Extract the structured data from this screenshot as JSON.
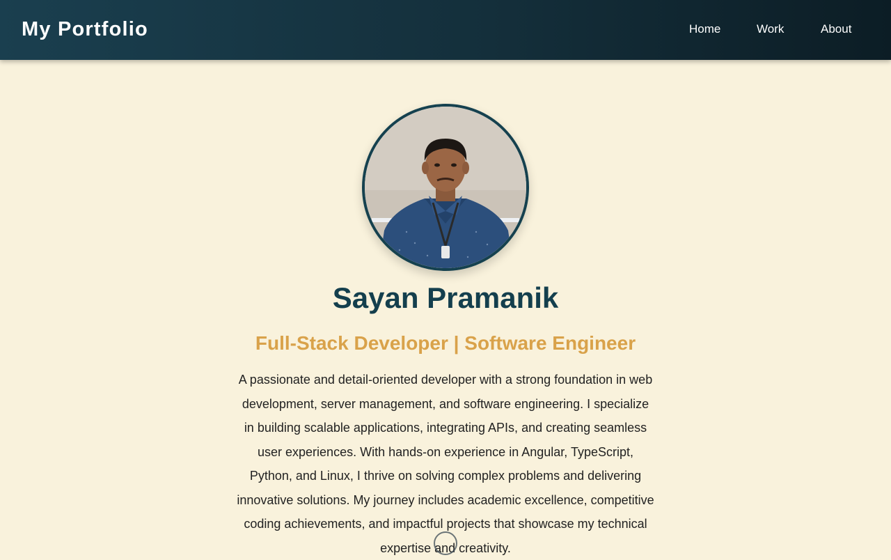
{
  "header": {
    "brand": "My Portfolio",
    "nav": [
      {
        "label": "Home"
      },
      {
        "label": "Work"
      },
      {
        "label": "About"
      }
    ]
  },
  "profile": {
    "photo_icon": "profile-photo",
    "name": "Sayan Pramanik",
    "title": "Full-Stack Developer | Software Engineer",
    "bio": "A passionate and detail-oriented developer with a strong foundation in web development, server management, and software engineering. I specialize in building scalable applications, integrating APIs, and creating seamless user experiences. With hands-on experience in Angular, TypeScript, Python, and Linux, I thrive on solving complex problems and delivering innovative solutions. My journey includes academic excellence, competitive coding achievements, and impactful projects that showcase my technical expertise and creativity."
  },
  "colors": {
    "header_bg": "#1a3f4f",
    "page_bg": "#f9f2dc",
    "name_color": "#143f4d",
    "accent": "#d9a24a"
  }
}
